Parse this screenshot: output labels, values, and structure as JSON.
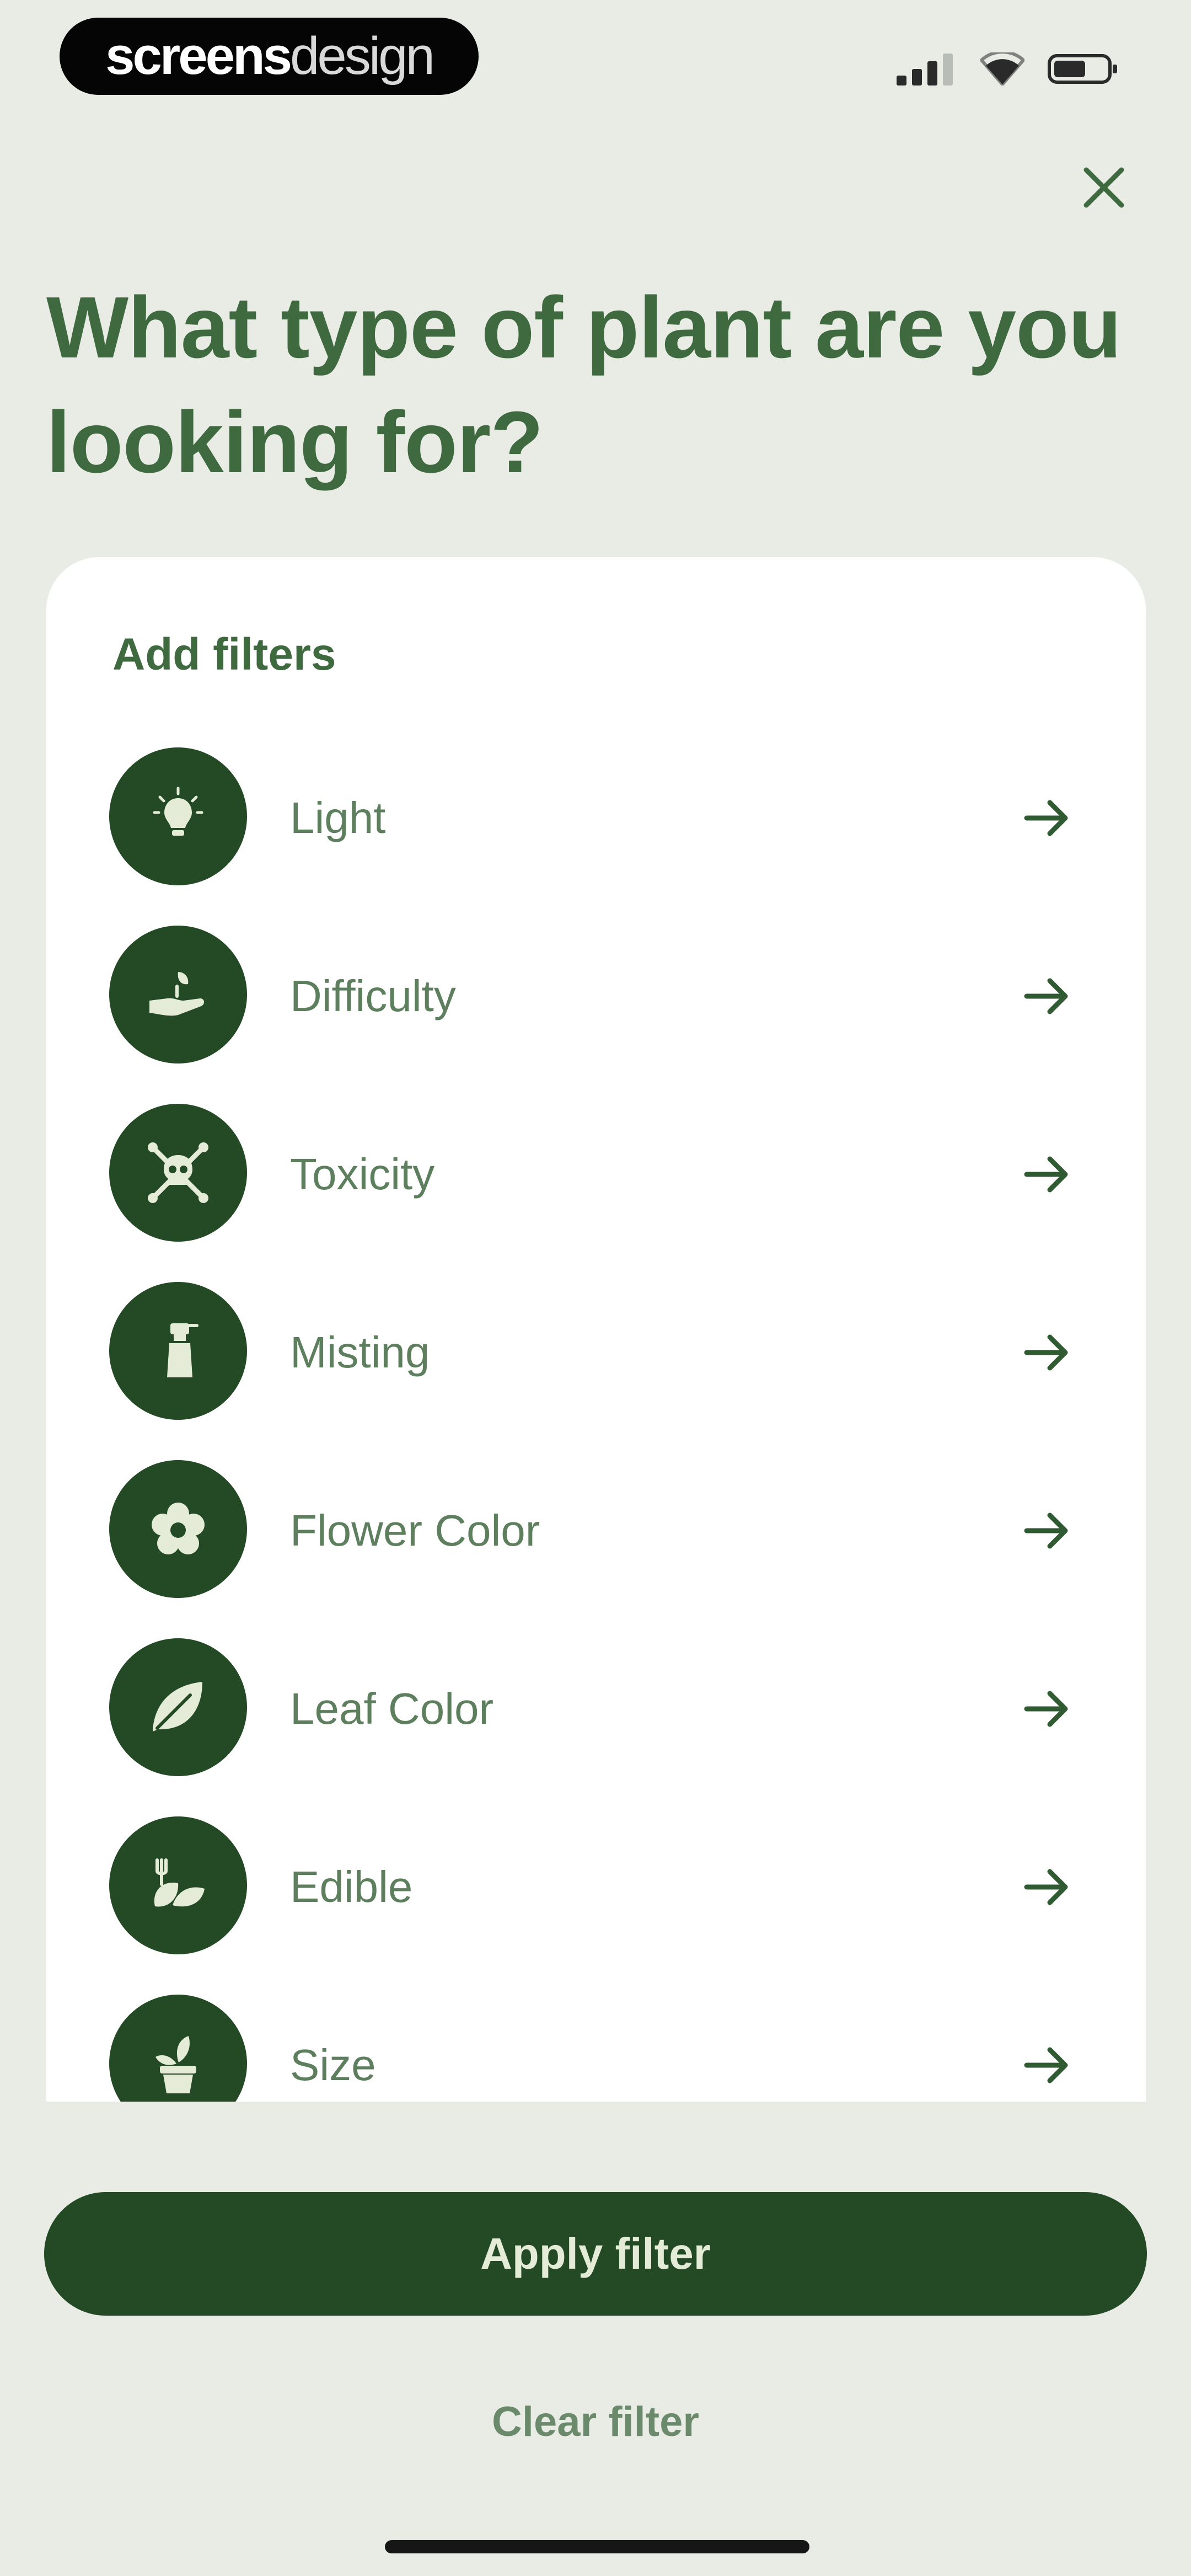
{
  "status_bar": {
    "watermark": {
      "part1": "screens",
      "part2": "design"
    },
    "icons": [
      "cellular-signal-icon",
      "wifi-icon",
      "battery-icon"
    ]
  },
  "header": {
    "close_icon": "close-icon",
    "title": "What type of plant are you looking for?"
  },
  "filters": {
    "heading": "Add filters",
    "items": [
      {
        "label": "Light",
        "icon": "light-bulb-icon"
      },
      {
        "label": "Difficulty",
        "icon": "hand-plant-icon"
      },
      {
        "label": "Toxicity",
        "icon": "skull-crossbones-icon"
      },
      {
        "label": "Misting",
        "icon": "spray-bottle-icon"
      },
      {
        "label": "Flower Color",
        "icon": "flower-icon"
      },
      {
        "label": "Leaf Color",
        "icon": "leaf-icon"
      },
      {
        "label": "Edible",
        "icon": "edible-plant-icon"
      },
      {
        "label": "Size",
        "icon": "potted-plant-icon"
      }
    ]
  },
  "actions": {
    "apply_label": "Apply filter",
    "clear_label": "Clear filter"
  },
  "colors": {
    "background": "#e8ece5",
    "primary": "#234a25",
    "title_text": "#3f6a40",
    "icon_fill": "#e4ecd7",
    "card": "#ffffff"
  }
}
